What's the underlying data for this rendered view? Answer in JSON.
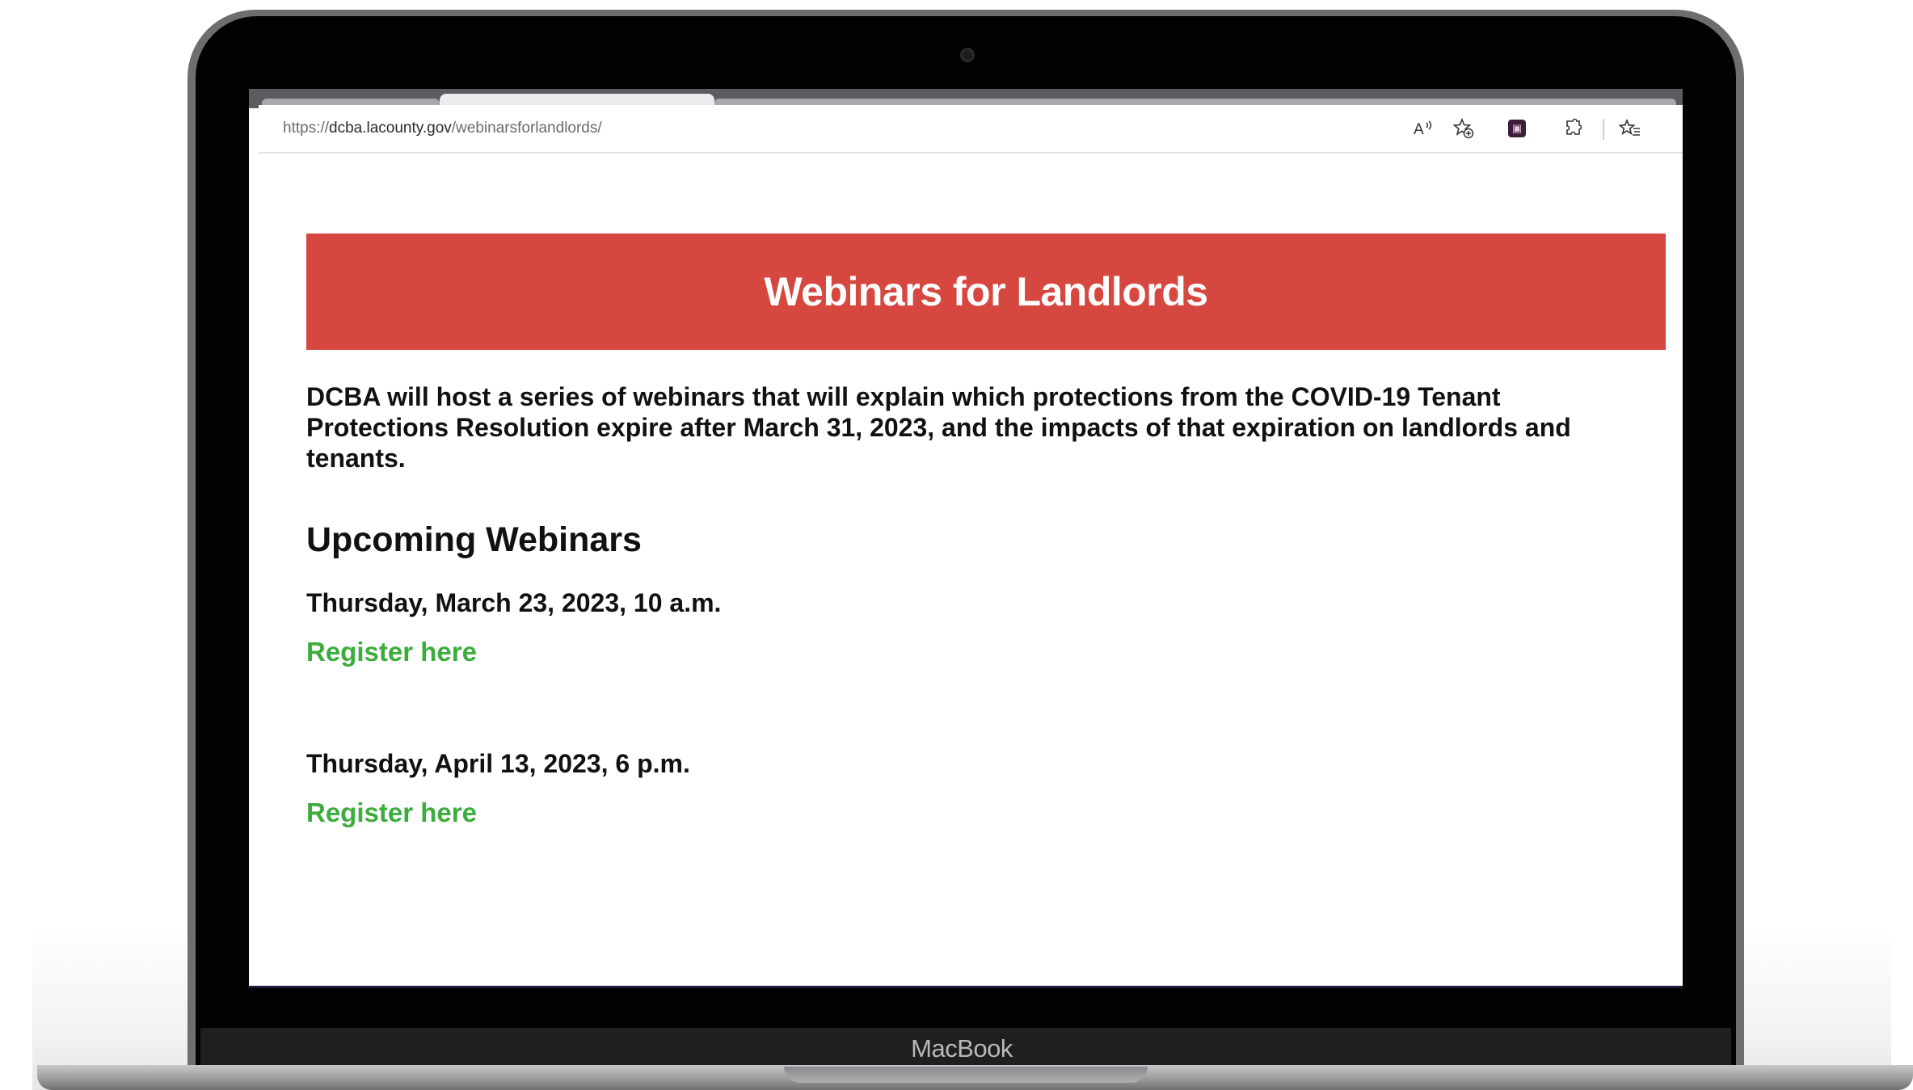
{
  "device": {
    "brand_label": "MacBook"
  },
  "browser": {
    "url_prefix": "https://",
    "url_domain": "dcba.lacounty.gov",
    "url_path": "/webinarsforlandlords/",
    "toolbar_icons": [
      "read-aloud-icon",
      "add-favorite-icon",
      "extension-icon",
      "puzzle-extensions-icon",
      "favorites-list-icon"
    ]
  },
  "page": {
    "banner_title": "Webinars for Landlords",
    "intro_text": "DCBA will host a series of webinars that will explain which protections from the COVID-19 Tenant Protections Resolution expire after March 31, 2023, and the impacts of that expiration on landlords and tenants.",
    "section_title": "Upcoming Webinars",
    "webinars": [
      {
        "date": "Thursday, March 23, 2023, 10 a.m.",
        "link_label": "Register here"
      },
      {
        "date": "Thursday, April 13, 2023, 6 p.m.",
        "link_label": "Register here"
      }
    ]
  },
  "colors": {
    "banner_bg": "#d64740",
    "link": "#3cad3c"
  }
}
